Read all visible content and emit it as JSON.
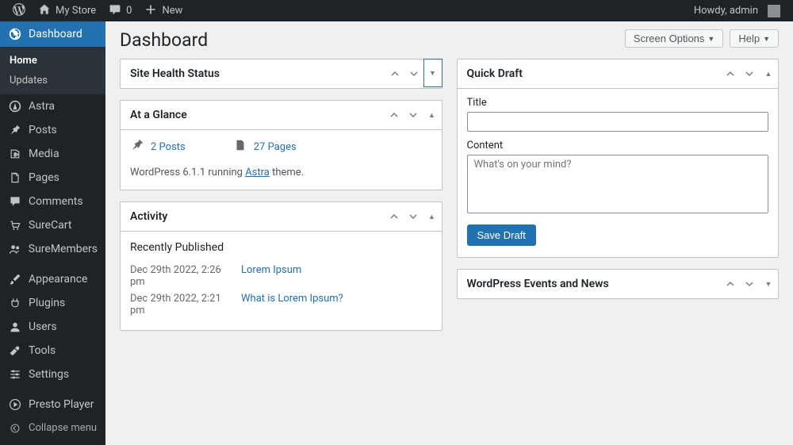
{
  "adminbar": {
    "site_name": "My Store",
    "comments_count": "0",
    "new_label": "New",
    "greeting": "Howdy, admin"
  },
  "sidebar": {
    "items": [
      {
        "label": "Dashboard"
      },
      {
        "label": "Astra"
      },
      {
        "label": "Posts"
      },
      {
        "label": "Media"
      },
      {
        "label": "Pages"
      },
      {
        "label": "Comments"
      },
      {
        "label": "SureCart"
      },
      {
        "label": "SureMembers"
      },
      {
        "label": "Appearance"
      },
      {
        "label": "Plugins"
      },
      {
        "label": "Users"
      },
      {
        "label": "Tools"
      },
      {
        "label": "Settings"
      },
      {
        "label": "Presto Player"
      },
      {
        "label": "Collapse menu"
      }
    ],
    "submenu": [
      {
        "label": "Home"
      },
      {
        "label": "Updates"
      }
    ]
  },
  "screen_options": "Screen Options",
  "help": "Help",
  "page_title": "Dashboard",
  "site_health": {
    "title": "Site Health Status"
  },
  "at_a_glance": {
    "title": "At a Glance",
    "posts": "2 Posts",
    "pages": "27 Pages",
    "version_pre": "WordPress 6.1.1 running ",
    "theme": "Astra",
    "version_post": " theme."
  },
  "activity": {
    "title": "Activity",
    "heading": "Recently Published",
    "rows": [
      {
        "date": "Dec 29th 2022, 2:26 pm",
        "title": "Lorem Ipsum"
      },
      {
        "date": "Dec 29th 2022, 2:21 pm",
        "title": "What is Lorem Ipsum?"
      }
    ]
  },
  "quick_draft": {
    "title": "Quick Draft",
    "title_label": "Title",
    "content_label": "Content",
    "content_placeholder": "What's on your mind?",
    "save_label": "Save Draft"
  },
  "events": {
    "title": "WordPress Events and News"
  }
}
